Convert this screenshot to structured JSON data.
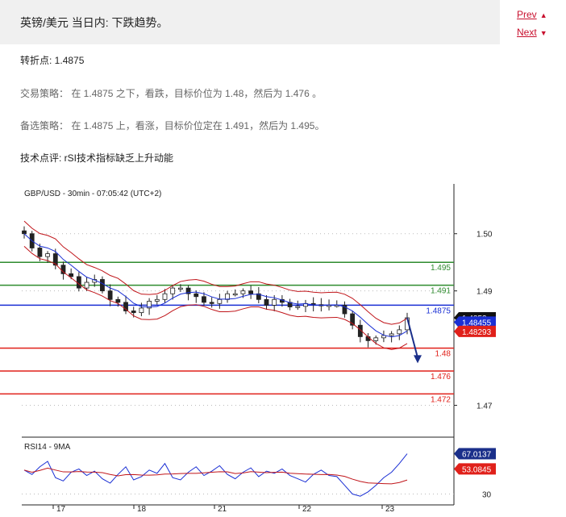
{
  "header": {
    "title": "英镑/美元 当日内: 下跌趋势。"
  },
  "nav": {
    "prev_label": "Prev",
    "next_label": "Next",
    "accent_color": "#c8102e"
  },
  "info": {
    "pivot_label": "转折点",
    "pivot_value": ": 1.4875",
    "strategy_label": "交易策略",
    "strategy_text": "：  在 1.4875 之下，看跌，目标价位为 1.48，然后为 1.476 。",
    "alt_label": "备选策略",
    "alt_text": "：  在 1.4875 上，看涨，目标价位定在 1.491，然后为 1.495。",
    "comment_label": "技术点评",
    "comment_text": ": rSI技术指标缺乏上升动能"
  },
  "chart_data": {
    "type": "candlestick",
    "title": "GBP/USD - 30min - 07:05:42 (UTC+2)",
    "x_tick_labels": [
      "17",
      "18",
      "21",
      "22",
      "23"
    ],
    "price_axis": {
      "ylim": [
        1.465,
        1.508
      ],
      "ticks": [
        1.47,
        1.49,
        1.5
      ]
    },
    "levels": [
      {
        "value": 1.495,
        "label": "1.495",
        "color": "#2e8b2e"
      },
      {
        "value": 1.491,
        "label": "1.491",
        "color": "#2e8b2e"
      },
      {
        "value": 1.4875,
        "label": "1.4875",
        "color": "#1a2fd4"
      },
      {
        "value": 1.48,
        "label": "1.48",
        "color": "#e0201a"
      },
      {
        "value": 1.476,
        "label": "1.476",
        "color": "#e0201a"
      },
      {
        "value": 1.472,
        "label": "1.472",
        "color": "#e0201a"
      }
    ],
    "current_price": {
      "value": 1.4853,
      "label": "1.4853",
      "color": "#111111"
    },
    "ma_value": {
      "value": 1.48455,
      "label": "1.48455",
      "color": "#1a2fd4"
    },
    "lower_band_value": {
      "value": 1.48293,
      "label": "1.48293",
      "color": "#e0201a"
    },
    "price_path": [
      1.5,
      1.4975,
      1.496,
      1.4965,
      1.4945,
      1.493,
      1.4925,
      1.4905,
      1.4915,
      1.492,
      1.49,
      1.4885,
      1.488,
      1.4865,
      1.4862,
      1.487,
      1.4882,
      1.4885,
      1.4895,
      1.4905,
      1.4905,
      1.4895,
      1.489,
      1.488,
      1.4878,
      1.4885,
      1.4895,
      1.4895,
      1.49,
      1.4895,
      1.4885,
      1.4875,
      1.4885,
      1.488,
      1.4872,
      1.4873,
      1.4878,
      1.4876,
      1.4875,
      1.4875,
      1.4875,
      1.486,
      1.484,
      1.482,
      1.4813,
      1.4818,
      1.4822,
      1.4825,
      1.4832,
      1.4853
    ],
    "projection_arrow_target": 1.4775,
    "rsi": {
      "label": "RSI14 - 9MA",
      "ylim": [
        20,
        80
      ],
      "ticks": [
        30
      ],
      "rsi_value": {
        "value": 67.0137,
        "label": "67.0137",
        "color": "#1a2fd4"
      },
      "ma_value": {
        "value": 53.0845,
        "label": "53.0845",
        "color": "#e0201a"
      },
      "path": [
        52,
        48,
        55,
        60,
        45,
        42,
        50,
        53,
        47,
        51,
        44,
        40,
        48,
        55,
        43,
        46,
        52,
        49,
        58,
        45,
        43,
        50,
        55,
        47,
        51,
        56,
        48,
        44,
        50,
        54,
        46,
        51,
        49,
        53,
        47,
        44,
        41,
        48,
        52,
        47,
        46,
        38,
        30,
        28,
        32,
        38,
        45,
        50,
        58,
        67
      ]
    }
  }
}
